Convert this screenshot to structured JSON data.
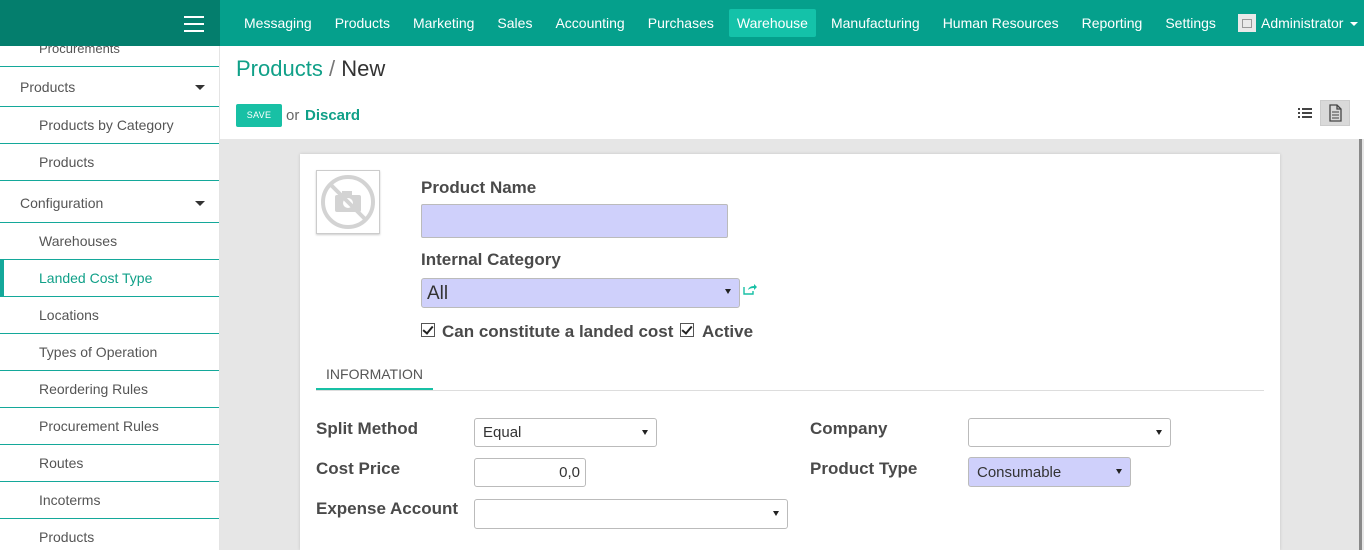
{
  "topbar": {
    "menu": [
      "Messaging",
      "Products",
      "Marketing",
      "Sales",
      "Accounting",
      "Purchases",
      "Warehouse",
      "Manufacturing",
      "Human Resources",
      "Reporting",
      "Settings"
    ],
    "active_menu": "Warehouse",
    "user": "Administrator",
    "colors": {
      "bar": "#05a08c",
      "brand": "#047e6d",
      "active": "#14c2a9"
    }
  },
  "sidebar": {
    "partial_top": "Procurements",
    "products_head": "Products",
    "products_by_category": "Products by Category",
    "products": "Products",
    "configuration_head": "Configuration",
    "warehouses": "Warehouses",
    "landed_cost_type": "Landed Cost Type",
    "locations": "Locations",
    "types_of_operation": "Types of Operation",
    "reordering_rules": "Reordering Rules",
    "procurement_rules": "Procurement Rules",
    "routes": "Routes",
    "incoterms": "Incoterms",
    "products_bottom": "Products"
  },
  "breadcrumb": {
    "parent": "Products",
    "separator": "/",
    "current": "New"
  },
  "actions": {
    "save": "SAVE",
    "or": "or",
    "discard": "Discard"
  },
  "form": {
    "product_name_label": "Product Name",
    "product_name_value": "",
    "internal_category_label": "Internal Category",
    "internal_category_value": "All",
    "landed_cost_label": "Can constitute a landed cost",
    "landed_cost_checked": true,
    "active_label": "Active",
    "active_checked": true,
    "tab_information": "INFORMATION",
    "split_method_label": "Split Method",
    "split_method_value": "Equal",
    "cost_price_label": "Cost Price",
    "cost_price_value": "0,0",
    "expense_account_label": "Expense Account",
    "expense_account_value": "",
    "company_label": "Company",
    "company_value": "",
    "product_type_label": "Product Type",
    "product_type_value": "Consumable"
  }
}
